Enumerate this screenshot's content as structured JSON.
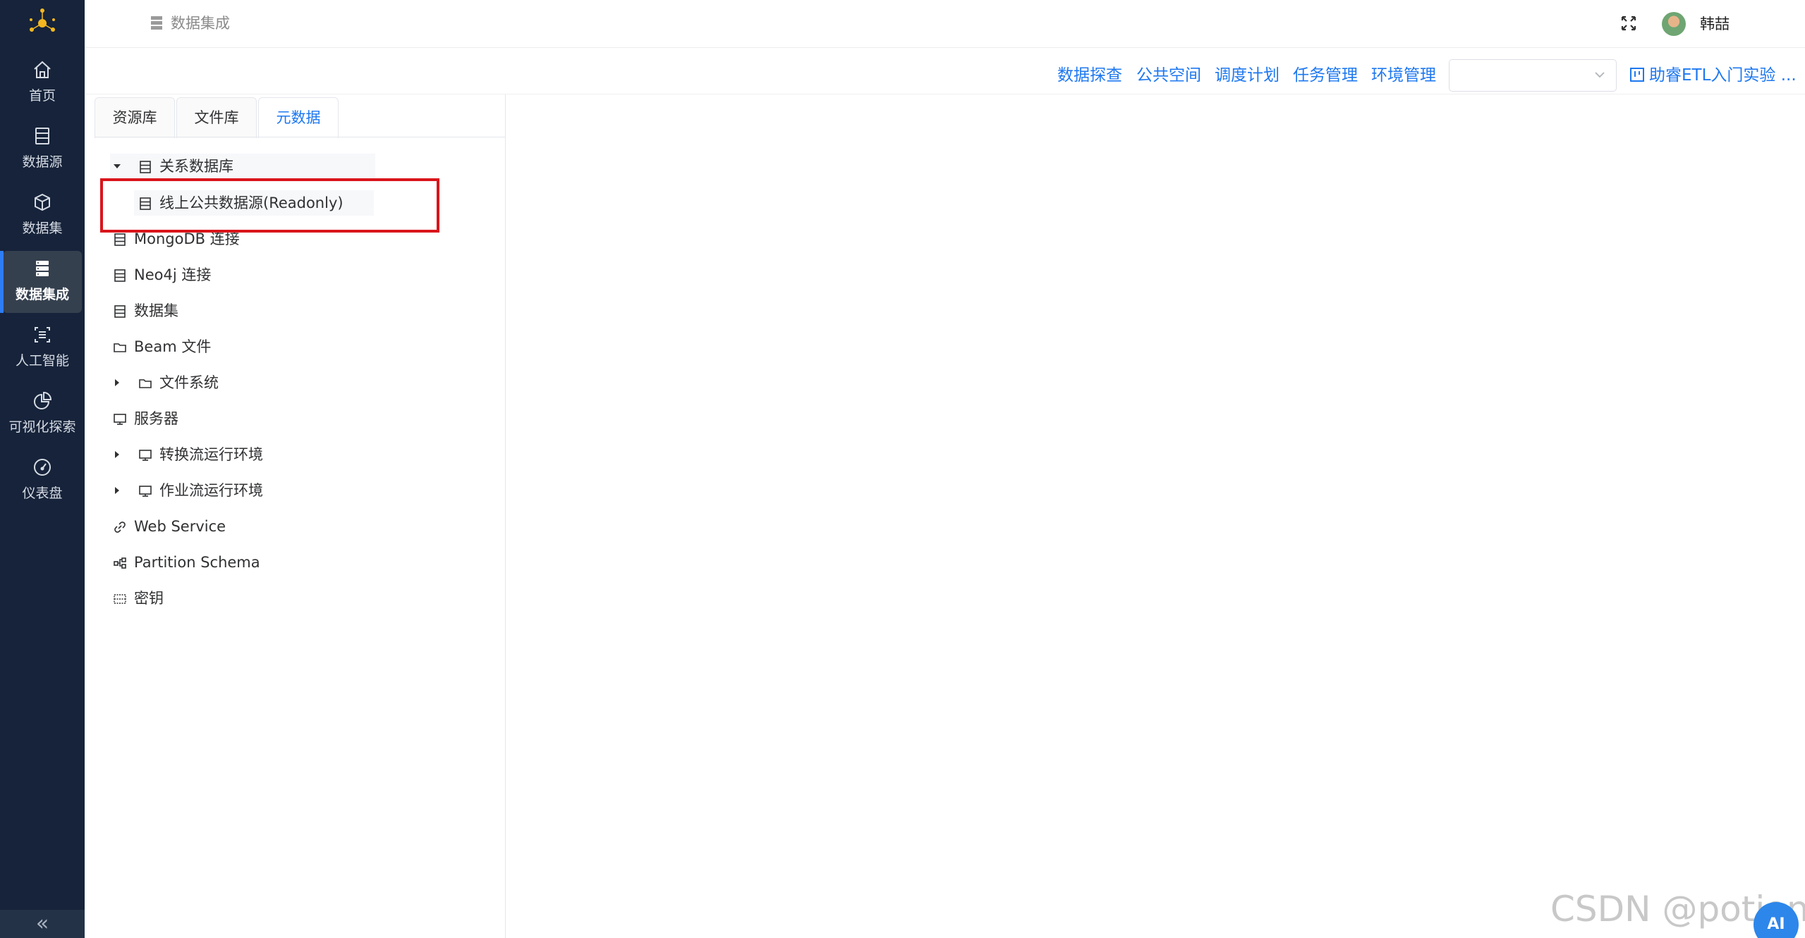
{
  "sidebar": {
    "items": [
      {
        "label": "首页",
        "icon": "home-icon"
      },
      {
        "label": "数据源",
        "icon": "database-icon"
      },
      {
        "label": "数据集",
        "icon": "cube-icon"
      },
      {
        "label": "数据集成",
        "icon": "stack-icon",
        "active": true
      },
      {
        "label": "人工智能",
        "icon": "ai-icon"
      },
      {
        "label": "可视化探索",
        "icon": "pie-chart-icon"
      },
      {
        "label": "仪表盘",
        "icon": "gauge-icon"
      }
    ],
    "collapse_label": "«"
  },
  "header": {
    "breadcrumb": "数据集成",
    "username": "韩喆"
  },
  "topnav": {
    "links": [
      "数据探查",
      "公共空间",
      "调度计划",
      "任务管理",
      "环境管理"
    ],
    "env_select_value": "",
    "project_link": "助睿ETL入门实验 ..."
  },
  "tabs": [
    "资源库",
    "文件库",
    "元数据"
  ],
  "active_tab": "元数据",
  "tree": {
    "rdb": "关系数据库",
    "online_source": "线上公共数据源(Readonly)",
    "mongodb": "MongoDB 连接",
    "neo4j": "Neo4j 连接",
    "dataset": "数据集",
    "beam": "Beam 文件",
    "filesystem": "文件系统",
    "server": "服务器",
    "transform_env": "转换流运行环境",
    "job_env": "作业流运行环境",
    "webservice": "Web Service",
    "partition": "Partition Schema",
    "secret": "密钥"
  },
  "watermark": "CSDN @potion()",
  "ai_badge": "AI",
  "colors": {
    "sidebar_bg": "#16233a",
    "accent": "#1e78f0",
    "highlight_box": "#d9151b"
  }
}
